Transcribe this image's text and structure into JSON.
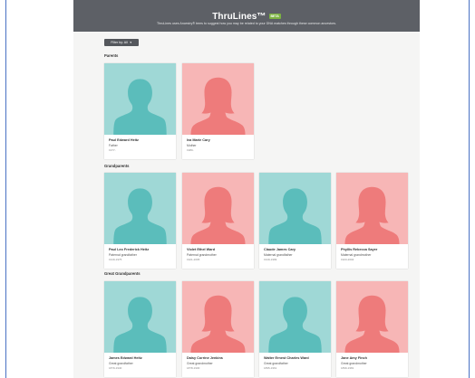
{
  "header": {
    "title": "ThruLines™",
    "badge": "BETA",
    "subtitle": "ThruLines uses Ancestry® trees to suggest how you may be related to your DNA matches through these common ancestors."
  },
  "filter": {
    "label": "Filter by: All",
    "icon": "chevron-down-icon"
  },
  "colors": {
    "male_bg": "#9fd8d6",
    "male_silhouette": "#5bbdbb",
    "female_bg": "#f7b6b6",
    "female_silhouette": "#ee7b7b",
    "header_bg": "#5d6066"
  },
  "sections": [
    {
      "title": "Parents",
      "people": [
        {
          "name": "Paul Edward Heitz",
          "relation": "Father",
          "dates": "1977-",
          "gender": "male"
        },
        {
          "name": "Iva Marie Cary",
          "relation": "Mother",
          "dates": "1980-",
          "gender": "female"
        }
      ]
    },
    {
      "title": "Grandparents",
      "people": [
        {
          "name": "Paul Leo Frederick Heitz",
          "relation": "Paternal grandfather",
          "dates": "1919-1975",
          "gender": "male"
        },
        {
          "name": "Violet Ethel Ward",
          "relation": "Paternal grandmother",
          "dates": "1921-2005",
          "gender": "female"
        },
        {
          "name": "Claude James Cary",
          "relation": "Maternal grandfather",
          "dates": "1919-1999",
          "gender": "male"
        },
        {
          "name": "Phyllis Rebecca Sayer",
          "relation": "Maternal grandmother",
          "dates": "1923-2004",
          "gender": "female"
        }
      ]
    },
    {
      "title": "Great Grandparents",
      "people": [
        {
          "name": "James Edward Heitz",
          "relation": "Great grandfather",
          "dates": "1879-1940",
          "gender": "male"
        },
        {
          "name": "Daisy Corrine Jenkins",
          "relation": "Great grandmother",
          "dates": "1878-1930",
          "gender": "female"
        },
        {
          "name": "Walter Ernest Charles Ward",
          "relation": "Great grandfather",
          "dates": "1895-1961",
          "gender": "male"
        },
        {
          "name": "Jane Amy Finch",
          "relation": "Great grandmother",
          "dates": "1899-1981",
          "gender": "female"
        }
      ]
    }
  ]
}
